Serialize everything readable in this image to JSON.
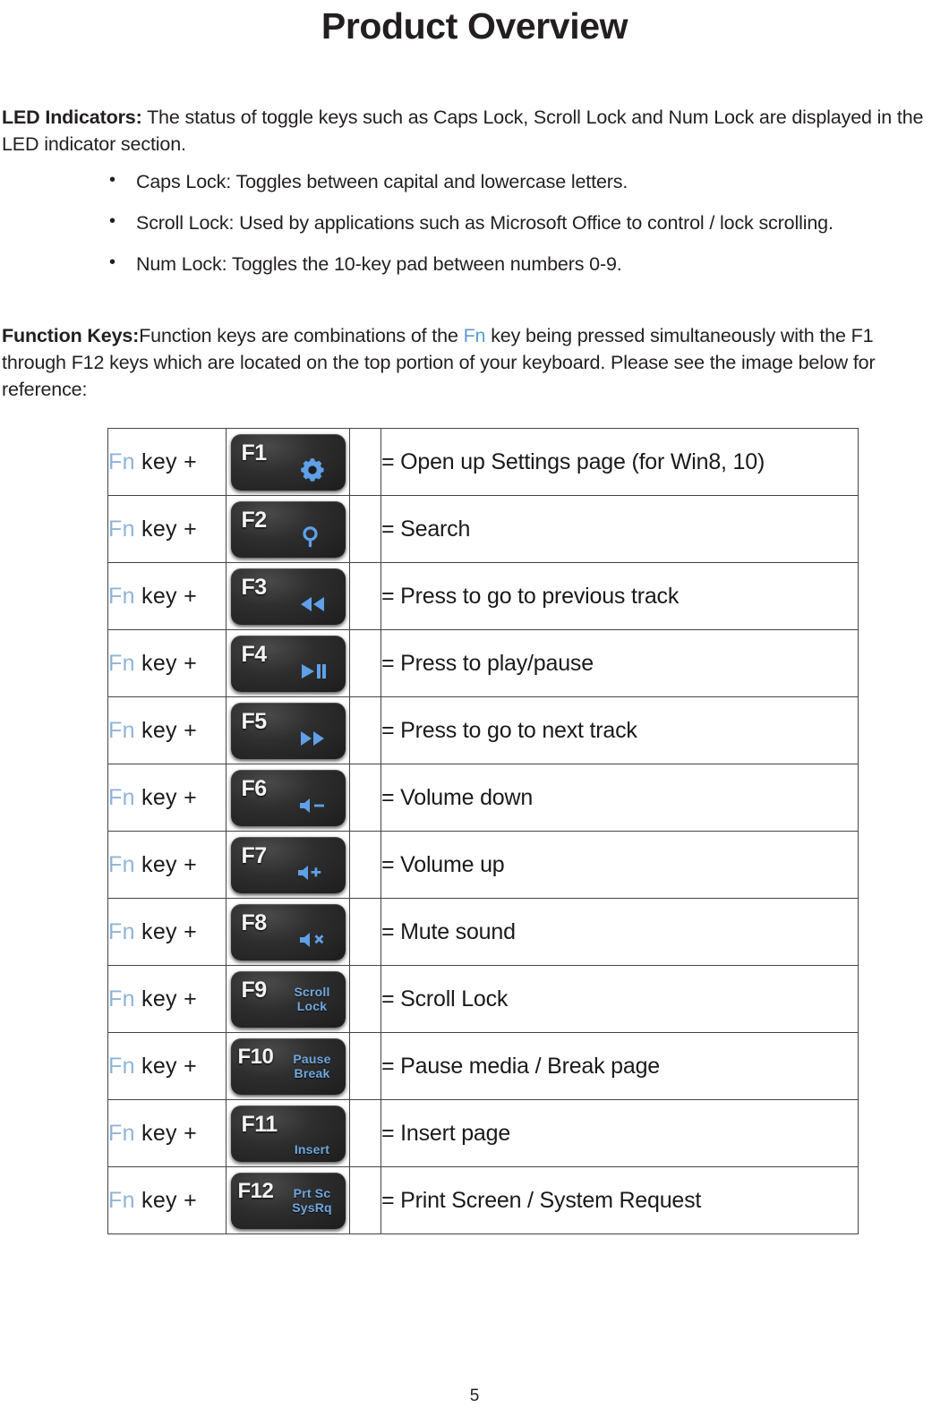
{
  "document": {
    "title": "Product Overview",
    "page_number": "5"
  },
  "led_section": {
    "lead_in": "LED Indicators:",
    "intro": " The status of toggle keys such as Caps Lock, Scroll Lock and Num Lock are displayed in the LED indicator section.",
    "bullets": [
      "Caps Lock: Toggles between capital and lowercase letters.",
      "Scroll Lock: Used by applications such as Microsoft Office to control / lock scrolling.",
      "Num Lock: Toggles the 10-key pad between numbers 0-9."
    ]
  },
  "function_section": {
    "lead_in": "Function Keys:",
    "text_before_fn": "Function keys are combinations of the ",
    "fn_highlight": "Fn",
    "text_after_fn": " key being pressed simultaneously with the F1 through F12 keys which are located on the top portion of your keyboard. Please see the image below for reference:",
    "fn_highlight_color": "#5b9bd5"
  },
  "fn_table": {
    "prefix_fn": "Fn",
    "prefix_rest": " key +",
    "rows": [
      {
        "key_label": "F1",
        "key_icon": "gear-icon",
        "key_sub_text": "",
        "description": "= Open up Settings page (for Win8, 10)"
      },
      {
        "key_label": "F2",
        "key_icon": "search-icon",
        "key_sub_text": "",
        "description": "= Search"
      },
      {
        "key_label": "F3",
        "key_icon": "previous-track-icon",
        "key_sub_text": "",
        "description": "= Press to go to previous track"
      },
      {
        "key_label": "F4",
        "key_icon": "play-pause-icon",
        "key_sub_text": "",
        "description": "= Press to play/pause"
      },
      {
        "key_label": "F5",
        "key_icon": "next-track-icon",
        "key_sub_text": "",
        "description": "= Press to go to next track"
      },
      {
        "key_label": "F6",
        "key_icon": "volume-down-icon",
        "key_sub_text": "",
        "description": "= Volume down"
      },
      {
        "key_label": "F7",
        "key_icon": "volume-up-icon",
        "key_sub_text": "",
        "description": "= Volume up"
      },
      {
        "key_label": "F8",
        "key_icon": "mute-icon",
        "key_sub_text": "",
        "description": "= Mute sound"
      },
      {
        "key_label": "F9",
        "key_icon": "",
        "key_sub_text": "Scroll\nLock",
        "description": "= Scroll Lock"
      },
      {
        "key_label": "F10",
        "key_icon": "",
        "key_sub_text": "Pause\nBreak",
        "description": "= Pause media / Break page"
      },
      {
        "key_label": "F11",
        "key_icon": "",
        "key_sub_text": "Insert",
        "description": "= Insert page"
      },
      {
        "key_label": "F12",
        "key_icon": "",
        "key_sub_text": "Prt Sc\nSysRq",
        "description": "= Print Screen / System Request"
      }
    ]
  }
}
